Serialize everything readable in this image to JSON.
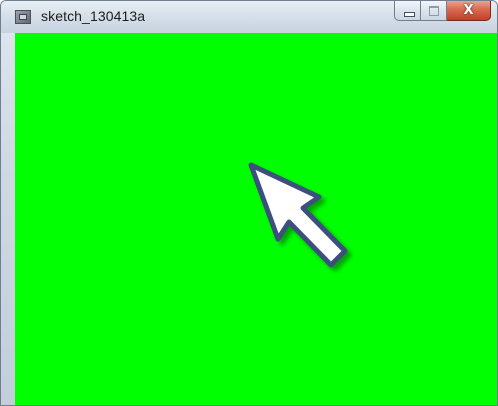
{
  "window": {
    "title": "sketch_130413a",
    "icon": "sketch-app-icon"
  },
  "controls": {
    "minimize": "minimize-icon",
    "maximize": "maximize-icon",
    "close_glyph": "X"
  },
  "canvas": {
    "background_color": "#00ff00"
  },
  "cursor": {
    "icon": "arrow-cursor-icon",
    "fill_color": "#ffffff",
    "outline_color": "#3c4f7c"
  }
}
